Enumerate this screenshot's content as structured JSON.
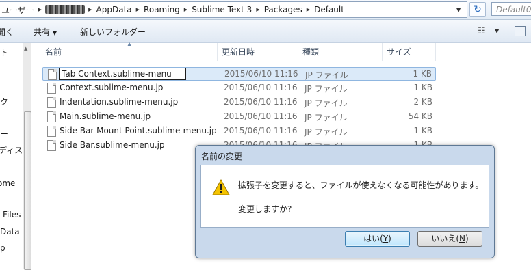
{
  "address_bar": {
    "crumbs": [
      "ユーザー",
      "AppData",
      "Roaming",
      "Sublime Text 3",
      "Packages",
      "Default"
    ],
    "search_placeholder": "Default0"
  },
  "toolbar": {
    "open_label": "開く",
    "share_label": "共有",
    "new_folder_label": "新しいフォルダー"
  },
  "nav_pane": {
    "items": [
      "ト",
      "ク",
      "ー",
      "ディス",
      "ome",
      "Files",
      "Data",
      "p"
    ]
  },
  "columns": {
    "name": "名前",
    "date": "更新日時",
    "type": "種類",
    "size": "サイズ"
  },
  "files": [
    {
      "name": "Tab Context.sublime-menu",
      "date": "2015/06/10 11:16",
      "type": "JP ファイル",
      "size": "1 KB"
    },
    {
      "name": "Context.sublime-menu.jp",
      "date": "2015/06/10 11:16",
      "type": "JP ファイル",
      "size": "1 KB"
    },
    {
      "name": "Indentation.sublime-menu.jp",
      "date": "2015/06/10 11:16",
      "type": "JP ファイル",
      "size": "2 KB"
    },
    {
      "name": "Main.sublime-menu.jp",
      "date": "2015/06/10 11:16",
      "type": "JP ファイル",
      "size": "54 KB"
    },
    {
      "name": "Side Bar Mount Point.sublime-menu.jp",
      "date": "2015/06/10 11:16",
      "type": "JP ファイル",
      "size": "1 KB"
    },
    {
      "name": "Side Bar.sublime-menu.jp",
      "date": "2015/06/10 11:16",
      "type": "JP ファイル",
      "size": "1 KB"
    }
  ],
  "rename_value": "Tab Context.sublime-menu",
  "dialog": {
    "title": "名前の変更",
    "message": "拡張子を変更すると、ファイルが使えなくなる可能性があります。",
    "question": "変更しますか?",
    "yes_label": "はい",
    "yes_key": "Y",
    "no_label": "いいえ",
    "no_key": "N"
  },
  "icons": {
    "warning": "warning-icon",
    "document": "document-icon",
    "refresh": "refresh-icon",
    "view": "view-options-icon",
    "preview_pane": "preview-pane-icon"
  },
  "colors": {
    "selection": "#dbeaf9",
    "dialog_frame": "#c9d9ec",
    "warning_yellow": "#f5c400"
  }
}
